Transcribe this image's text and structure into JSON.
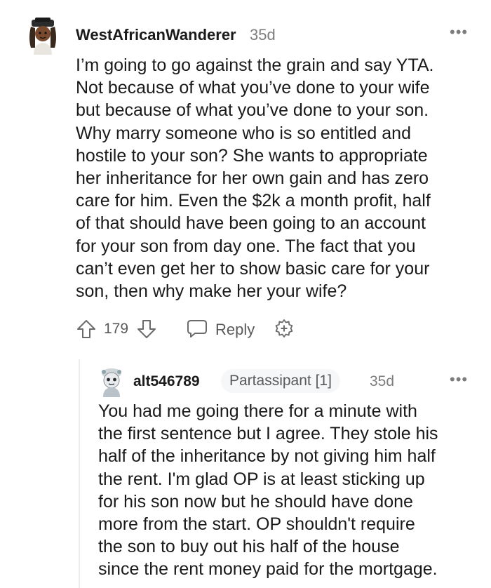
{
  "comment": {
    "username": "WestAfricanWanderer",
    "age": "35d",
    "more": "•••",
    "lines": [
      "I’m going to go against the grain and say YTA.",
      "Not because of what you’ve done to your wife",
      "but because of what you’ve done to your son.",
      "Why marry someone who is so entitled and",
      "hostile to your son? She wants to appropriate",
      "her inheritance for her own gain and has zero",
      "care for him. Even the $2k a month profit, half",
      "of that should have been going to an account",
      "for your son from day one. The fact that you",
      "can’t even get her to show basic care for your",
      "son, then why make her your wife?"
    ],
    "score": "179",
    "reply_label": "Reply"
  },
  "reply": {
    "username": "alt546789",
    "flair": "Partassipant [1]",
    "age": "35d",
    "more": "•••",
    "lines": [
      "You had me going there for a minute with",
      "the first sentence but I agree. They stole his",
      "half of the inheritance by not giving him half",
      "the rent. I'm glad OP is at least sticking up",
      "for his son now but he should have done",
      "more from the start. OP shouldn't require",
      "the son to buy out his half of the house",
      "since the rent money paid for the mortgage."
    ]
  },
  "icons": {
    "upvote": "upvote-arrow-icon",
    "downvote": "downvote-arrow-icon",
    "reply": "speech-bubble-icon",
    "award": "award-plus-icon"
  }
}
